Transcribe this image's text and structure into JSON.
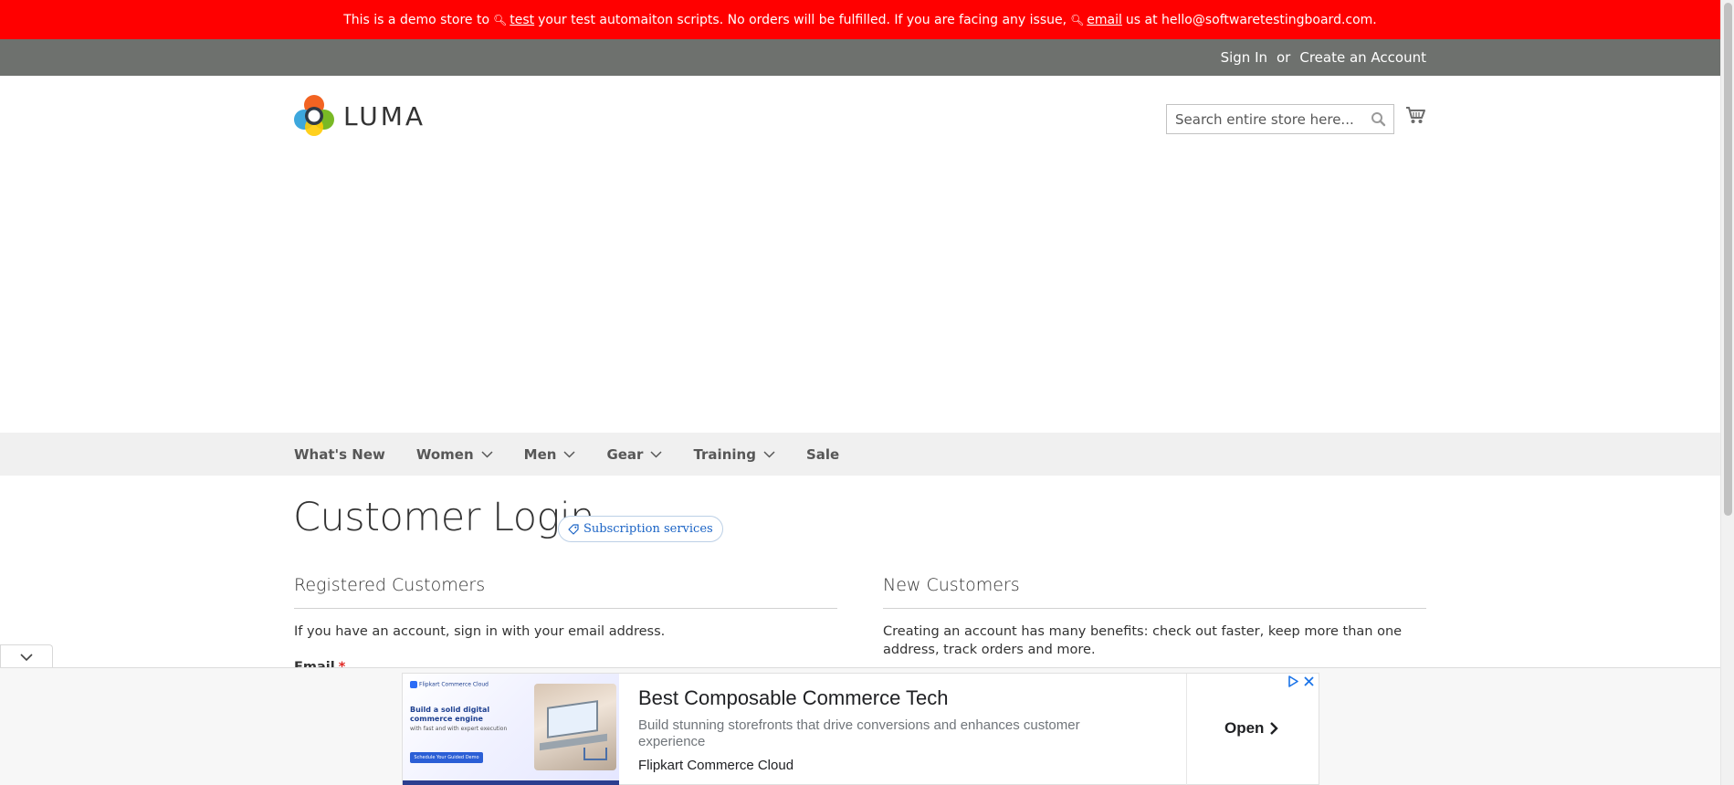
{
  "demo_notice": {
    "part1": "This is a demo store to",
    "link1": "test",
    "part2": "your test automaiton scripts. No orders will be fulfilled. If you are facing any issue,",
    "link2": "email",
    "part3": "us at hello@softwaretestingboard.com."
  },
  "header_panel": {
    "sign_in": "Sign In",
    "or": "or",
    "create_account": "Create an Account"
  },
  "logo": {
    "text": "LUMA"
  },
  "search": {
    "placeholder": "Search entire store here..."
  },
  "nav": {
    "items": [
      {
        "label": "What's New",
        "has_dropdown": false
      },
      {
        "label": "Women",
        "has_dropdown": true
      },
      {
        "label": "Men",
        "has_dropdown": true
      },
      {
        "label": "Gear",
        "has_dropdown": true
      },
      {
        "label": "Training",
        "has_dropdown": true
      },
      {
        "label": "Sale",
        "has_dropdown": false
      }
    ]
  },
  "page": {
    "title": "Customer Login",
    "subscription_badge": "Subscription services"
  },
  "registered": {
    "title": "Registered Customers",
    "intro": "If you have an account, sign in with your email address.",
    "email_label": "Email",
    "required_mark": "*"
  },
  "new_customers": {
    "title": "New Customers",
    "intro": "Creating an account has many benefits: check out faster, keep more than one address, track orders and more."
  },
  "ad": {
    "image_brand": "Flipkart Commerce Cloud",
    "image_headline": "Build a solid digital commerce engine",
    "image_subline": "with fast and with expert execution",
    "image_cta": "Schedule Your Guided Demo",
    "title": "Best Composable Commerce Tech",
    "description": "Build stunning storefronts that drive conversions and enhances customer experience",
    "advertiser": "Flipkart Commerce Cloud",
    "open_label": "Open"
  },
  "colors": {
    "demo_bar": "#ff0000",
    "panel_bar": "#6e716e",
    "nav_bar": "#f0f0f0",
    "badge_text": "#1a63c5",
    "required": "#e02b27"
  }
}
